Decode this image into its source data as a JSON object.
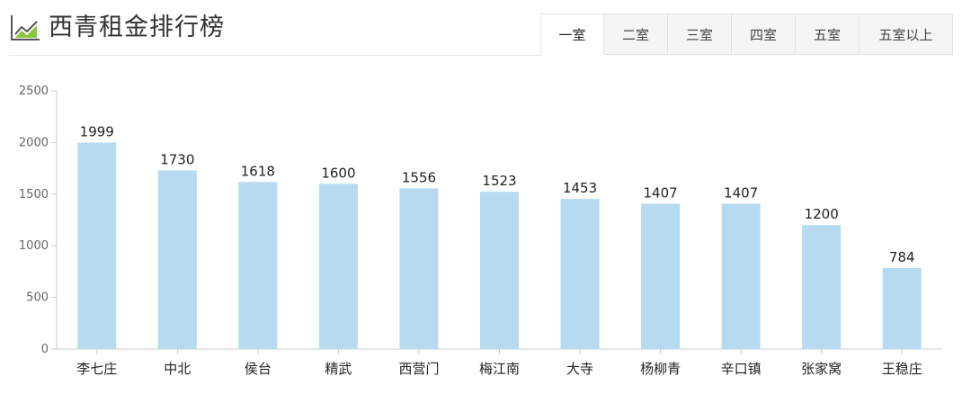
{
  "header": {
    "title": "西青租金排行榜",
    "icon": "line-chart-icon"
  },
  "tabs": [
    {
      "label": "一室",
      "active": true
    },
    {
      "label": "二室",
      "active": false
    },
    {
      "label": "三室",
      "active": false
    },
    {
      "label": "四室",
      "active": false
    },
    {
      "label": "五室",
      "active": false
    },
    {
      "label": "五室以上",
      "active": false
    }
  ],
  "colors": {
    "bar": "#b6daf0",
    "axis": "#cccccc"
  },
  "chart_data": {
    "type": "bar",
    "categories": [
      "李七庄",
      "中北",
      "侯台",
      "精武",
      "西营门",
      "梅江南",
      "大寺",
      "杨柳青",
      "辛口镇",
      "张家窝",
      "王稳庄"
    ],
    "values": [
      1999,
      1730,
      1618,
      1600,
      1556,
      1523,
      1453,
      1407,
      1407,
      1200,
      784
    ],
    "ylim": [
      0,
      2500
    ],
    "yticks": [
      0,
      500,
      1000,
      1500,
      2000,
      2500
    ],
    "grid": false,
    "data_labels": true
  }
}
